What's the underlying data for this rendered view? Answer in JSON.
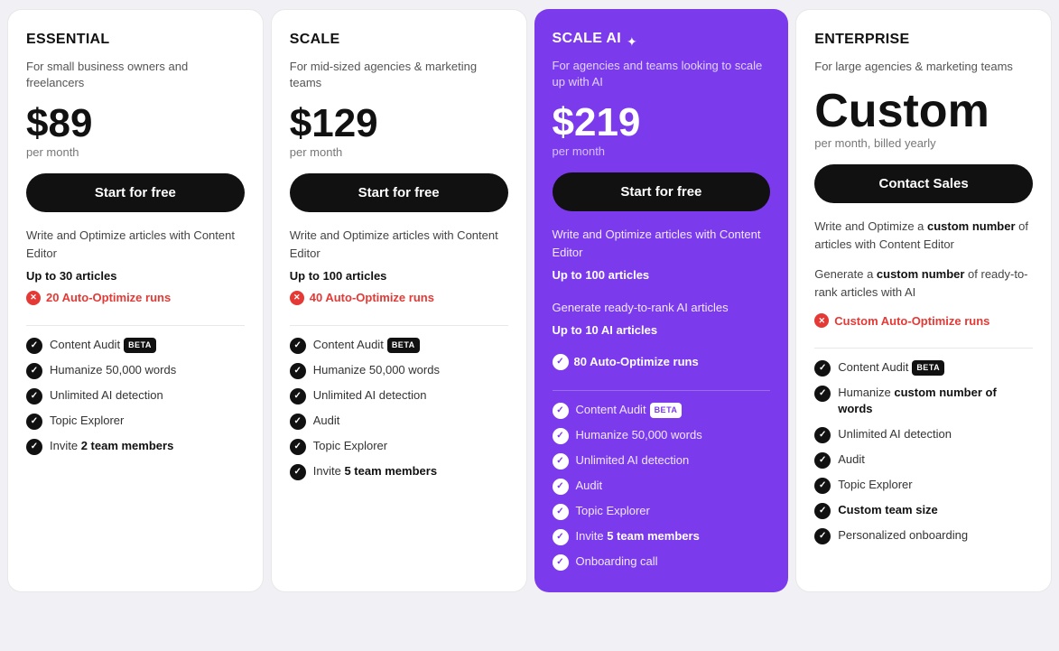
{
  "plans": [
    {
      "id": "essential",
      "name": "ESSENTIAL",
      "subtitle": "For small business owners and freelancers",
      "price": "$89",
      "period": "per month",
      "cta": "Start for free",
      "highlighted": false,
      "description_lines": [
        "Write and Optimize articles with Content Editor",
        "Up to 30 articles"
      ],
      "auto_optimize": {
        "label": "20 Auto-Optimize runs",
        "type": "red_x"
      },
      "features": [
        {
          "label": "Content Audit",
          "badge": "BETA"
        },
        {
          "label": "Humanize 50,000 words"
        },
        {
          "label": "Unlimited AI detection"
        },
        {
          "label": "Topic Explorer"
        },
        {
          "label": "Invite ",
          "bold_suffix": "2 team members"
        }
      ]
    },
    {
      "id": "scale",
      "name": "SCALE",
      "subtitle": "For mid-sized agencies & marketing teams",
      "price": "$129",
      "period": "per month",
      "cta": "Start for free",
      "highlighted": false,
      "description_lines": [
        "Write and Optimize articles with Content Editor",
        "Up to 100 articles"
      ],
      "auto_optimize": {
        "label": "40 Auto-Optimize runs",
        "type": "red_x"
      },
      "features": [
        {
          "label": "Content Audit",
          "badge": "BETA"
        },
        {
          "label": "Humanize 50,000 words"
        },
        {
          "label": "Unlimited AI detection"
        },
        {
          "label": "Audit"
        },
        {
          "label": "Topic Explorer"
        },
        {
          "label": "Invite ",
          "bold_suffix": "5 team members"
        }
      ]
    },
    {
      "id": "scale_ai",
      "name": "SCALE AI",
      "subtitle": "For agencies and teams looking to scale up with AI",
      "price": "$219",
      "period": "per month",
      "cta": "Start for free",
      "highlighted": true,
      "description_lines": [
        "Write and Optimize articles with Content Editor",
        "Up to 100 articles",
        "Generate ready-to-rank AI articles",
        "Up to 10 AI articles"
      ],
      "auto_optimize": {
        "label": "80 Auto-Optimize runs",
        "type": "check"
      },
      "features": [
        {
          "label": "Content Audit",
          "badge": "BETA"
        },
        {
          "label": "Humanize 50,000 words"
        },
        {
          "label": "Unlimited AI detection"
        },
        {
          "label": "Audit"
        },
        {
          "label": "Topic Explorer"
        },
        {
          "label": "Invite ",
          "bold_suffix": "5 team members"
        },
        {
          "label": "Onboarding call"
        }
      ]
    },
    {
      "id": "enterprise",
      "name": "ENTERPRISE",
      "subtitle": "For large agencies & marketing teams",
      "price": "Custom",
      "period": "per month, billed yearly",
      "cta": "Contact Sales",
      "highlighted": false,
      "description_lines": [
        "Write and Optimize a custom number of articles with Content Editor",
        "Generate a custom number of ready-to-rank articles with AI"
      ],
      "auto_optimize": {
        "label": "Custom Auto-Optimize runs",
        "type": "red_x"
      },
      "features": [
        {
          "label": "Content Audit",
          "badge": "BETA"
        },
        {
          "label": "Humanize ",
          "bold_suffix": "custom number of words"
        },
        {
          "label": "Unlimited AI detection"
        },
        {
          "label": "Audit"
        },
        {
          "label": "Topic Explorer"
        },
        {
          "label": "Custom team size",
          "bold": true
        },
        {
          "label": "Personalized onboarding"
        }
      ]
    }
  ]
}
